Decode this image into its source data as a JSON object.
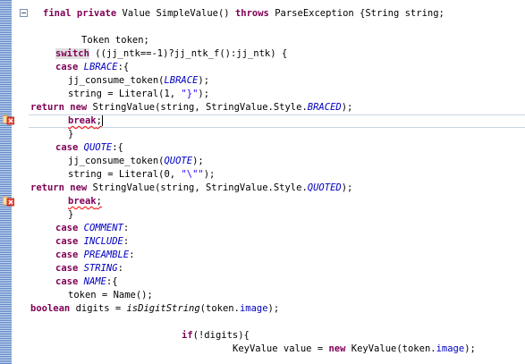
{
  "editor": {
    "lines": [
      {
        "id": "l1",
        "segments": [
          {
            "t": "final private",
            "c": "kw"
          },
          {
            "t": " Value SimpleValue() "
          },
          {
            "t": "throws",
            "c": "kw"
          },
          {
            "t": " ParseException {String string;"
          }
        ]
      },
      {
        "id": "l2",
        "segments": [
          {
            "t": ""
          }
        ]
      },
      {
        "id": "l3",
        "segments": [
          {
            "t": "Token token;"
          }
        ]
      },
      {
        "id": "l4",
        "segments": [
          {
            "t": "switch",
            "c": "kw hl"
          },
          {
            "t": " ((jj_ntk==-1)?jj_ntk_f():jj_ntk) {"
          }
        ]
      },
      {
        "id": "l5",
        "segments": [
          {
            "t": "case",
            "c": "kw"
          },
          {
            "t": " "
          },
          {
            "t": "LBRACE",
            "c": "cst"
          },
          {
            "t": ":{"
          }
        ]
      },
      {
        "id": "l6",
        "segments": [
          {
            "t": "jj_consume_token("
          },
          {
            "t": "LBRACE",
            "c": "cst"
          },
          {
            "t": ");"
          }
        ]
      },
      {
        "id": "l7",
        "segments": [
          {
            "t": "string = Literal(1, "
          },
          {
            "t": "\"}\"",
            "c": "str"
          },
          {
            "t": ");"
          }
        ]
      },
      {
        "id": "l8",
        "segments": [
          {
            "t": "return",
            "c": "kw"
          },
          {
            "t": " "
          },
          {
            "t": "new",
            "c": "kw"
          },
          {
            "t": " StringValue(string, StringValue.Style."
          },
          {
            "t": "BRACED",
            "c": "cst"
          },
          {
            "t": ");"
          }
        ]
      },
      {
        "id": "l9",
        "segments": [
          {
            "t": "break",
            "c": "kw err"
          },
          {
            "t": ";",
            "c": "err"
          }
        ]
      },
      {
        "id": "l10",
        "segments": [
          {
            "t": "}"
          }
        ]
      },
      {
        "id": "l11",
        "segments": [
          {
            "t": "case",
            "c": "kw"
          },
          {
            "t": " "
          },
          {
            "t": "QUOTE",
            "c": "cst"
          },
          {
            "t": ":{"
          }
        ]
      },
      {
        "id": "l12",
        "segments": [
          {
            "t": "jj_consume_token("
          },
          {
            "t": "QUOTE",
            "c": "cst"
          },
          {
            "t": ");"
          }
        ]
      },
      {
        "id": "l13",
        "segments": [
          {
            "t": "string = Literal(0, "
          },
          {
            "t": "\"\\\"\"",
            "c": "str"
          },
          {
            "t": ");"
          }
        ]
      },
      {
        "id": "l14",
        "segments": [
          {
            "t": "return",
            "c": "kw"
          },
          {
            "t": " "
          },
          {
            "t": "new",
            "c": "kw"
          },
          {
            "t": " StringValue(string, StringValue.Style."
          },
          {
            "t": "QUOTED",
            "c": "cst"
          },
          {
            "t": ");"
          }
        ]
      },
      {
        "id": "l15",
        "segments": [
          {
            "t": "break",
            "c": "kw err"
          },
          {
            "t": ";",
            "c": "err"
          }
        ]
      },
      {
        "id": "l16",
        "segments": [
          {
            "t": "}"
          }
        ]
      },
      {
        "id": "l17",
        "segments": [
          {
            "t": "case",
            "c": "kw"
          },
          {
            "t": " "
          },
          {
            "t": "COMMENT",
            "c": "cst"
          },
          {
            "t": ":"
          }
        ]
      },
      {
        "id": "l18",
        "segments": [
          {
            "t": "case",
            "c": "kw"
          },
          {
            "t": " "
          },
          {
            "t": "INCLUDE",
            "c": "cst"
          },
          {
            "t": ":"
          }
        ]
      },
      {
        "id": "l19",
        "segments": [
          {
            "t": "case",
            "c": "kw"
          },
          {
            "t": " "
          },
          {
            "t": "PREAMBLE",
            "c": "cst"
          },
          {
            "t": ":"
          }
        ]
      },
      {
        "id": "l20",
        "segments": [
          {
            "t": "case",
            "c": "kw"
          },
          {
            "t": " "
          },
          {
            "t": "STRING",
            "c": "cst"
          },
          {
            "t": ":"
          }
        ]
      },
      {
        "id": "l21",
        "segments": [
          {
            "t": "case",
            "c": "kw"
          },
          {
            "t": " "
          },
          {
            "t": "NAME",
            "c": "cst"
          },
          {
            "t": ":{"
          }
        ]
      },
      {
        "id": "l22",
        "segments": [
          {
            "t": "token = Name();"
          }
        ]
      },
      {
        "id": "l23",
        "segments": [
          {
            "t": "boolean",
            "c": "kw"
          },
          {
            "t": " digits = "
          },
          {
            "t": "isDigitString",
            "c": "mth"
          },
          {
            "t": "(token."
          },
          {
            "t": "image",
            "c": "fld"
          },
          {
            "t": ");"
          }
        ]
      },
      {
        "id": "l24",
        "segments": [
          {
            "t": ""
          }
        ]
      },
      {
        "id": "l25",
        "segments": [
          {
            "t": "if",
            "c": "kw"
          },
          {
            "t": "(!digits){"
          }
        ]
      },
      {
        "id": "l26",
        "segments": [
          {
            "t": "KeyValue value = "
          },
          {
            "t": "new",
            "c": "kw"
          },
          {
            "t": " KeyValue(token."
          },
          {
            "t": "image",
            "c": "fld"
          },
          {
            "t": ");"
          }
        ]
      }
    ],
    "markers": [
      {
        "id": "m1",
        "icon": "error-icon",
        "line": "l9",
        "message": "x"
      },
      {
        "id": "m2",
        "icon": "error-icon",
        "line": "l15",
        "message": "x"
      }
    ],
    "colors": {
      "keyword": "#7f0055",
      "constant": "#0000c0",
      "string": "#2a00ff",
      "error_underline": "#ff0000",
      "change_ruler": "#5f86c6"
    }
  }
}
